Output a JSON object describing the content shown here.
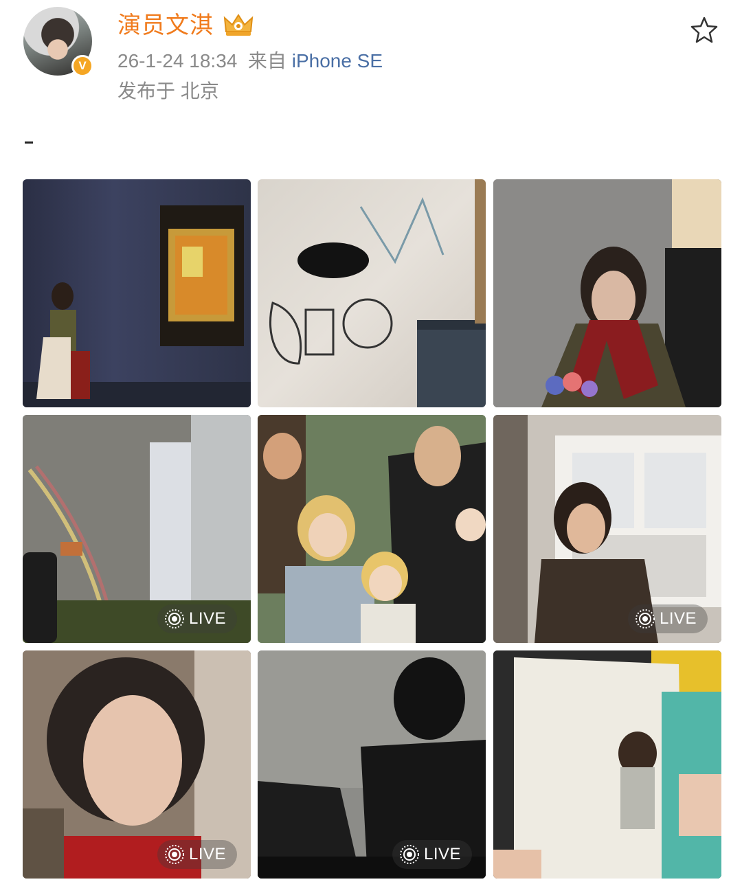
{
  "post": {
    "username": "演员文淇",
    "timestamp": "26-1-24 18:34",
    "source_prefix": "来自",
    "device": "iPhone SE",
    "location": "发布于 北京",
    "body_text": "-"
  },
  "icons": {
    "verified_badge": "V",
    "favorite": "star-icon",
    "crown": "crown-icon"
  },
  "colors": {
    "username": "#f07b1d",
    "device_link": "#4a6fa5",
    "meta": "#8a8a8a",
    "verified": "#f5a623"
  },
  "photos": [
    {
      "id": "photo-1",
      "live": false
    },
    {
      "id": "photo-2",
      "live": false
    },
    {
      "id": "photo-3",
      "live": false
    },
    {
      "id": "photo-4",
      "live": true
    },
    {
      "id": "photo-5",
      "live": false
    },
    {
      "id": "photo-6",
      "live": true
    },
    {
      "id": "photo-7",
      "live": true
    },
    {
      "id": "photo-8",
      "live": true
    },
    {
      "id": "photo-9",
      "live": false
    }
  ],
  "live_label": "LIVE"
}
